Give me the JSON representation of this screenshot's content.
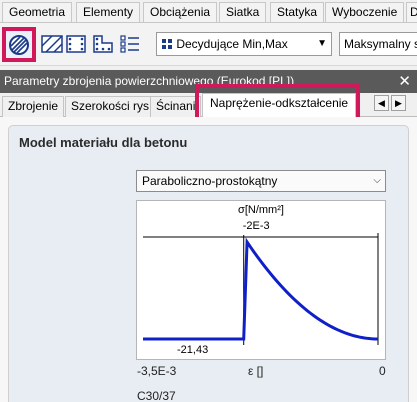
{
  "menu": {
    "tabs": [
      "Geometria",
      "Elementy",
      "Obciążenia",
      "Siatka",
      "Statyka",
      "Wyboczenie",
      "D"
    ]
  },
  "toolbar": {
    "combo1": "Decydujące Min,Max",
    "combo2": "Maksymalny s"
  },
  "panel": {
    "title": "Parametry zbrojenia powierzchniowego (Eurokod [PL])",
    "close_icon": "close-icon"
  },
  "subtabs": {
    "items": [
      "Zbrojenie",
      "Szerokości rys",
      "Ścinani",
      "Naprężenie-odkształcenie"
    ]
  },
  "section": {
    "title": "Model materiału dla betonu",
    "model_select": "Paraboliczno-prostokątny"
  },
  "chart_data": {
    "type": "line",
    "ylabel": "σ[N/mm²]",
    "xlabel": "ε []",
    "x": [
      -0.0035,
      -0.002,
      -0.0015,
      -0.001,
      -0.0005,
      0
    ],
    "y": [
      -21.43,
      -21.43,
      -16.07,
      -9.52,
      -3.93,
      0
    ],
    "xlim": [
      -0.0035,
      0
    ],
    "ylim": [
      -21.43,
      0
    ],
    "annotations": {
      "x_marker_label": "-2E-3",
      "y_min_label": "-21,43",
      "x_min_label": "-3,5E-3",
      "x_max_label": "0"
    },
    "series_color": "#1020c8"
  },
  "footer": {
    "material": "C30/37"
  },
  "colors": {
    "highlight": "#d0185a",
    "panel_bar": "#5a5a5a"
  }
}
